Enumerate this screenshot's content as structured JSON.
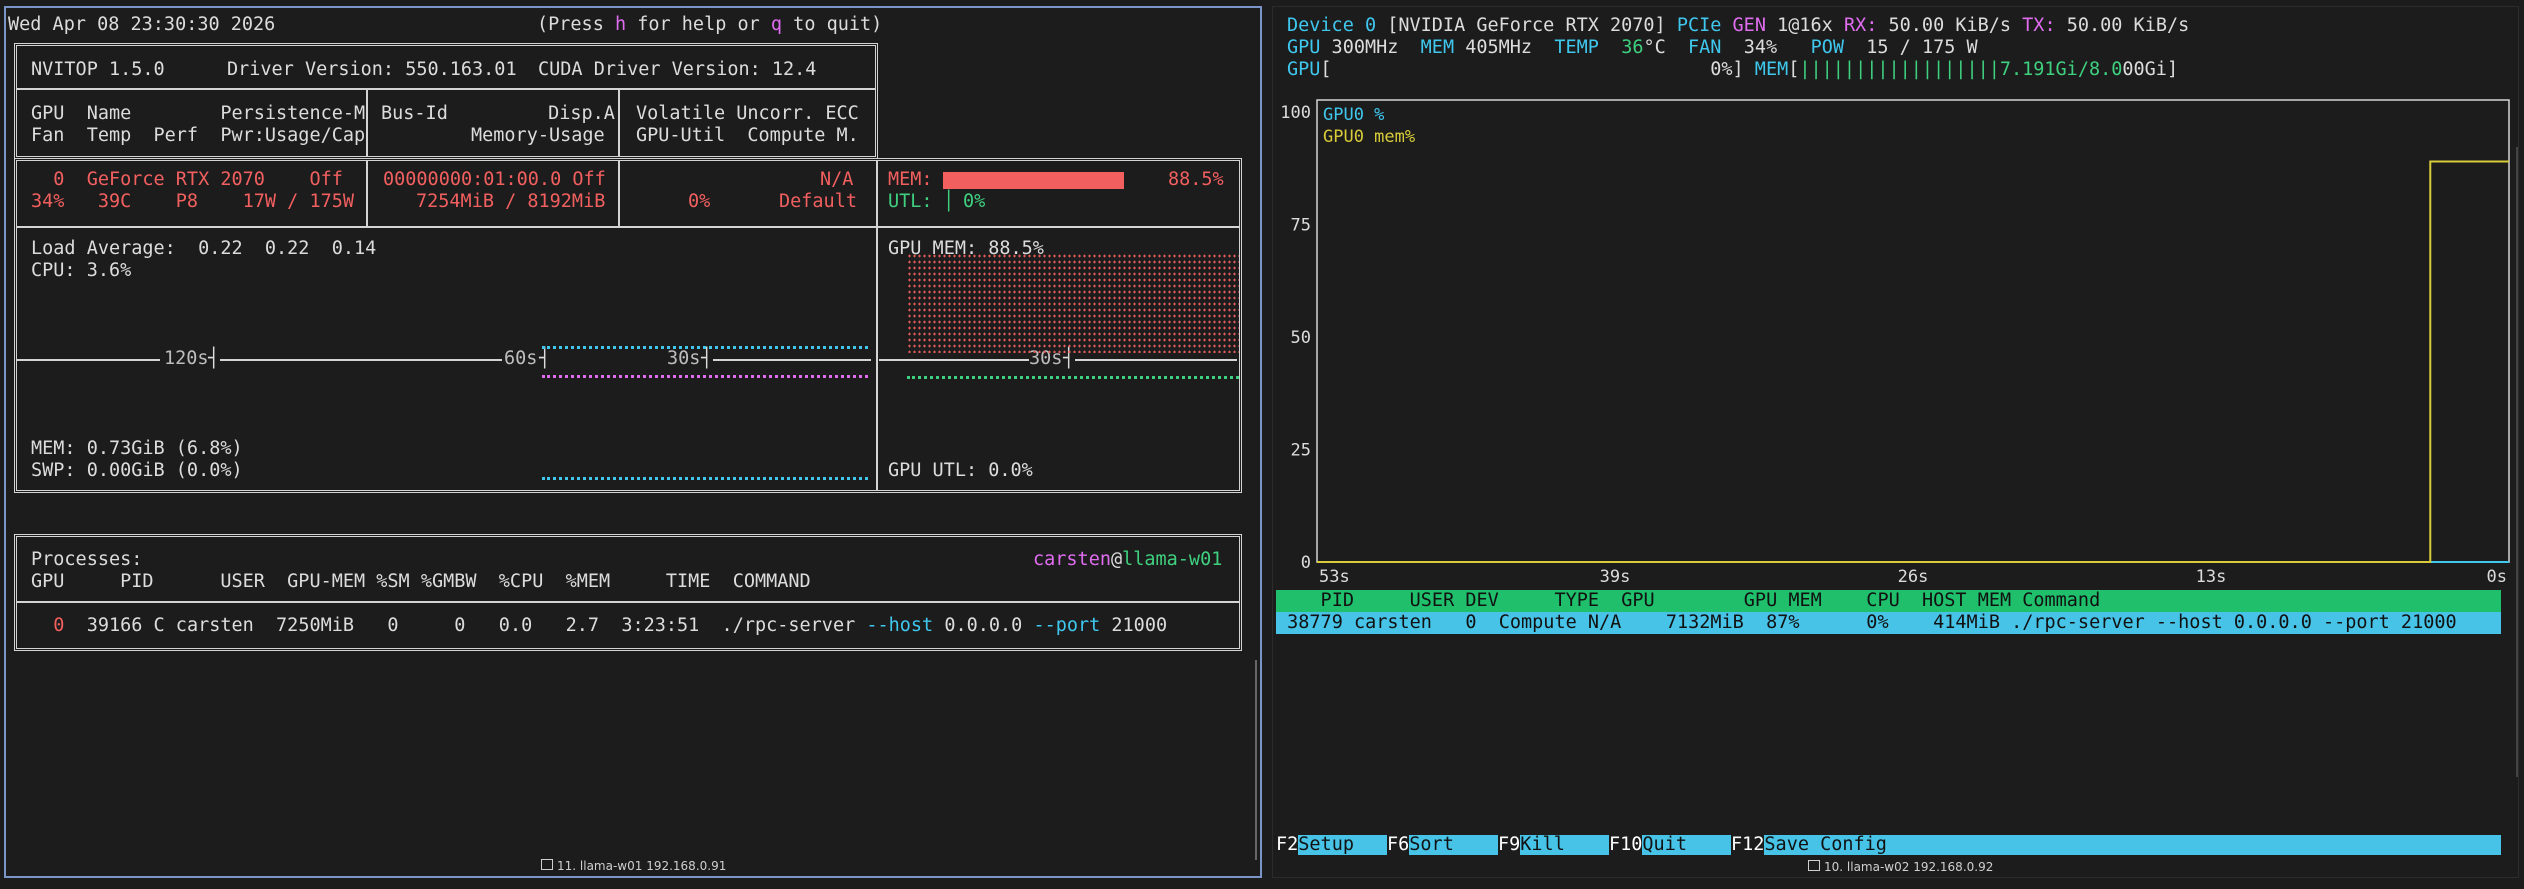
{
  "left": {
    "clock": "Wed Apr 08 23:30:30 2026",
    "help_prefix": "(Press ",
    "help_key": "h",
    "help_mid": " for help or ",
    "quit_key": "q",
    "help_suffix": " to quit)",
    "nvitop_version": "NVITOP 1.5.0",
    "driver_version": "Driver Version: 550.163.01",
    "cuda_version": "CUDA Driver Version: 12.4",
    "hdr1_l1": "GPU  Name        Persistence-M",
    "hdr1_l2": "Fan  Temp  Perf  Pwr:Usage/Cap",
    "hdr2_l1": "Bus-Id         Disp.A",
    "hdr2_l2": "Memory-Usage",
    "hdr3_l1": "Volatile Uncorr. ECC",
    "hdr3_l2": "GPU-Util  Compute M.",
    "gpu_row1_a": "  0  GeForce RTX 2070    Off",
    "gpu_row2_a": "34%   39C    P8    17W / 175W",
    "gpu_row1_b": "00000000:01:00.0 Off",
    "gpu_row2_b": "7254MiB / 8192MiB",
    "gpu_row1_c": "N/A",
    "gpu_row2_c_util": "0%",
    "gpu_row2_c_compute": "Default",
    "mem_label": "MEM:",
    "mem_pct": "88.5%",
    "mem_fraction": 0.885,
    "utl_label": "UTL:",
    "utl_pct": "0%",
    "load_average": "Load Average:  0.22  0.22  0.14",
    "cpu": "CPU: 3.6%",
    "t120": "120s",
    "t60": "60s",
    "t30a": "30s",
    "t30b": "30s",
    "mem_stat": "MEM: 0.73GiB (6.8%)",
    "swp_stat": "SWP: 0.00GiB (0.0%)",
    "gpu_mem_stat": "GPU MEM: 88.5%",
    "gpu_utl_stat": "GPU UTL: 0.0%",
    "processes_label": "Processes:",
    "user": "carsten",
    "at": "@",
    "host": "llama-w01",
    "proc_header": "GPU     PID      USER  GPU-MEM %SM %GMBW  %CPU  %MEM     TIME  COMMAND",
    "proc_gpu": "  0",
    "proc_rest": "  39166 C carsten  7250MiB   0     0   0.0   2.7  3:23:51  ./rpc-server ",
    "proc_host_flag": "--host",
    "proc_host_val": " 0.0.0.0 ",
    "proc_port_flag": "--port",
    "proc_port_val": " 21000",
    "window_title": "11. llama-w01 192.168.0.91"
  },
  "right": {
    "device_label": "Device 0",
    "device_name": " [NVIDIA GeForce RTX 2070] ",
    "pcie_label": "PCIe",
    "gen_label": " GEN ",
    "gen_value": "1@16x",
    "rx_label": " RX:",
    "rx_value": " 50.00 KiB/s",
    "tx_label": " TX:",
    "tx_value": " 50.00 KiB/s",
    "gpu_label": "GPU",
    "gpu_clock": " 300MHz  ",
    "mem_label": "MEM",
    "mem_clock": " 405MHz  ",
    "temp_label": "TEMP",
    "temp_value": "  ",
    "temp_num": "36",
    "temp_unit": "°C",
    "fan_label": "  FAN",
    "fan_value": "  34%   ",
    "pow_label": "POW",
    "pow_value": "  15 / 175 W",
    "gpu_bar_label": "GPU",
    "gpu_bar": "[                                  0%]",
    "mem_bar_label": " MEM",
    "mem_bar_open": "[",
    "mem_bar_fill": "||||||||||||||||||7.191Gi/8.0",
    "mem_bar_rest": "00Gi]",
    "legend_gpu": "GPU0 %",
    "legend_mem": "GPU0 mem%",
    "window_title": "10. llama-w02 192.168.0.92",
    "table_header": "    PID     USER DEV     TYPE  GPU        GPU MEM    CPU  HOST MEM Command",
    "table_row": " 38779 carsten   0  Compute N/A    7132MiB  87%      0%    414MiB ./rpc-server --host 0.0.0.0 --port 21000",
    "fkeys": [
      {
        "key": "F2",
        "label": "Setup"
      },
      {
        "key": "F6",
        "label": "Sort"
      },
      {
        "key": "F9",
        "label": "Kill"
      },
      {
        "key": "F10",
        "label": "Quit"
      },
      {
        "key": "F12",
        "label": "Save Config"
      }
    ]
  },
  "chart_data": {
    "type": "line",
    "ylim": [
      0,
      100
    ],
    "yticks": [
      "100",
      "75",
      "50",
      "25",
      "0"
    ],
    "xticks": [
      "53s",
      "39s",
      "26s",
      "13s",
      "0s"
    ],
    "series": [
      {
        "name": "GPU0 %",
        "color": "#3fc7ee",
        "x": [
          -53,
          -1,
          0
        ],
        "y": [
          0,
          0,
          0
        ]
      },
      {
        "name": "GPU0 mem%",
        "color": "#d8cc3a",
        "x": [
          -53,
          -3.5,
          -3.5,
          0
        ],
        "y": [
          0,
          0,
          89,
          89
        ]
      }
    ]
  }
}
